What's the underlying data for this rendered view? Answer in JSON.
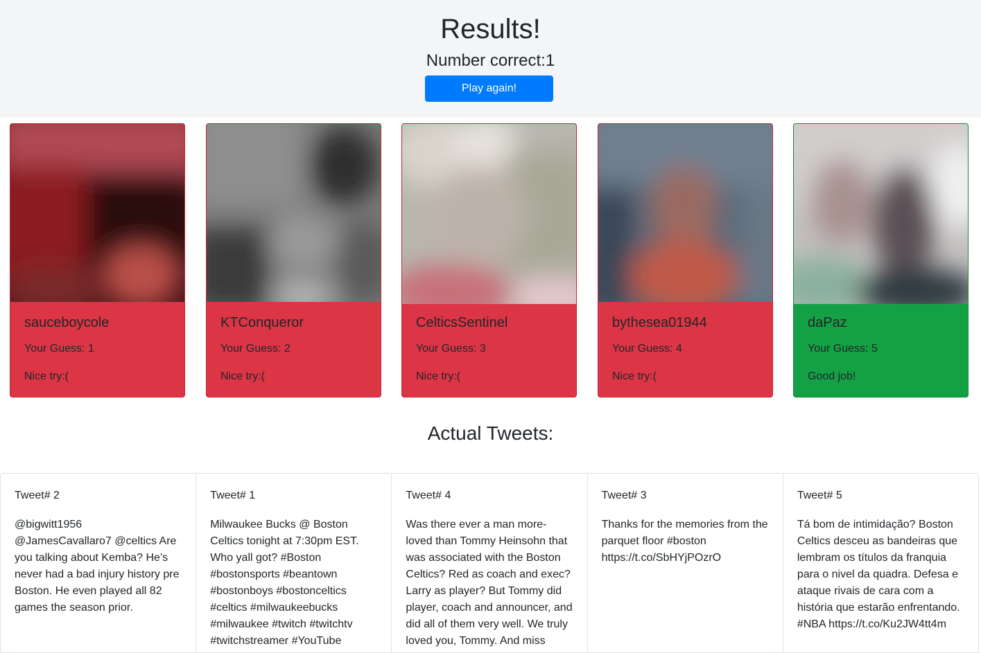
{
  "header": {
    "title": "Results!",
    "score_text": "Number correct:1",
    "play_again_label": "Play again!"
  },
  "cards": [
    {
      "username": "sauceboycole",
      "guess": "Your Guess: 1",
      "verdict": "Nice try:(",
      "status": "wrong"
    },
    {
      "username": "KTConqueror",
      "guess": "Your Guess: 2",
      "verdict": "Nice try:(",
      "status": "wrong"
    },
    {
      "username": "CelticsSentinel",
      "guess": "Your Guess: 3",
      "verdict": "Nice try:(",
      "status": "wrong"
    },
    {
      "username": "bythesea01944",
      "guess": "Your Guess: 4",
      "verdict": "Nice try:(",
      "status": "wrong"
    },
    {
      "username": "daPaz",
      "guess": "Your Guess: 5",
      "verdict": "Good job!",
      "status": "correct"
    }
  ],
  "tweets_section": {
    "title": "Actual Tweets:",
    "tweets": [
      {
        "label": "Tweet# 2",
        "text": "@bigwitt1956 @JamesCavallaro7 @celtics Are you talking about Kemba? He’s never had a bad injury history pre Boston. He even played all 82 games the season prior."
      },
      {
        "label": "Tweet# 1",
        "text": "Milwaukee Bucks @ Boston Celtics tonight at 7:30pm EST. Who yall got? #Boston #bostonsports #beantown #bostonboys #bostonceltics #celtics #milwaukeebucks #milwaukee #twitch #twitchtv #twitchstreamer #YouTube"
      },
      {
        "label": "Tweet# 4",
        "text": "Was there ever a man more-loved than Tommy Heinsohn that was associated with the Boston Celtics? Red as coach and exec? Larry as player? But Tommy did player, coach and announcer, and did all of them very well. We truly loved you, Tommy. And miss"
      },
      {
        "label": "Tweet# 3",
        "text": "Thanks for the memories from the parquet floor #boston https://t.co/SbHYjPOzrO"
      },
      {
        "label": "Tweet# 5",
        "text": "Tá bom de intimidação? Boston Celtics desceu as bandeiras que lembram os títulos da franquia para o nivel da quadra. Defesa e ataque rivais de cara com a história que estarão enfrentando. #NBA https://t.co/Ku2JW4tt4m"
      }
    ]
  },
  "colors": {
    "wrong": "#dc3545",
    "correct": "#14a044",
    "primary_button": "#007bff",
    "header_bg": "#f4f5f7"
  }
}
